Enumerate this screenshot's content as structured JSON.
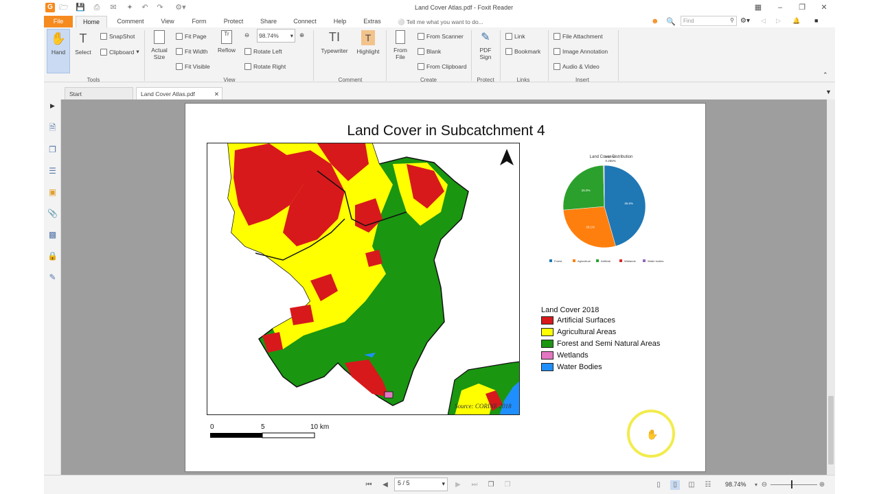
{
  "window": {
    "title": "Land Cover Atlas.pdf - Foxit Reader",
    "logo": "G"
  },
  "ribbon_tabs": [
    "File",
    "Home",
    "Comment",
    "View",
    "Form",
    "Protect",
    "Share",
    "Connect",
    "Help",
    "Extras"
  ],
  "tell_me": "Tell me what you want to do...",
  "find_placeholder": "Find",
  "tools": {
    "hand": "Hand",
    "select": "Select",
    "snapshot": "SnapShot",
    "clipboard": "Clipboard",
    "actual_size": "Actual Size",
    "fit_page": "Fit Page",
    "fit_width": "Fit Width",
    "fit_visible": "Fit Visible",
    "reflow": "Reflow",
    "zoom_value": "98.74%",
    "rotate_left": "Rotate Left",
    "rotate_right": "Rotate Right",
    "typewriter": "Typewriter",
    "highlight": "Highlight",
    "from_file": "From File",
    "from_scanner": "From Scanner",
    "blank": "Blank",
    "from_clipboard": "From Clipboard",
    "pdf_sign": "PDF Sign",
    "link": "Link",
    "bookmark": "Bookmark",
    "file_attachment": "File Attachment",
    "image_annotation": "Image Annotation",
    "audio_video": "Audio & Video"
  },
  "groups": {
    "tools": "Tools",
    "view": "View",
    "comment": "Comment",
    "create": "Create",
    "protect": "Protect",
    "links": "Links",
    "insert": "Insert"
  },
  "doc_tabs": [
    "Start",
    "Land Cover Atlas.pdf"
  ],
  "page": {
    "title": "Land Cover in Subcatchment 4",
    "pie_title": "Land Cover Distribution",
    "pie_labels": [
      "45.6%",
      "28.1%",
      "26.0%",
      "0.137%",
      "0.255%"
    ],
    "pie_legend": [
      "Forest",
      "Agriculture",
      "Artificial",
      "Wetlands",
      "Water bodies"
    ],
    "legend_title": "Land Cover 2018",
    "legend": [
      {
        "label": "Artificial Surfaces",
        "color": "#d7191c"
      },
      {
        "label": "Agricultural Areas",
        "color": "#ffff00"
      },
      {
        "label": "Forest and Semi Natural Areas",
        "color": "#1a9611"
      },
      {
        "label": "Wetlands",
        "color": "#e377c2"
      },
      {
        "label": "Water Bodies",
        "color": "#1f8fff"
      }
    ],
    "source": "Source: CORINE 2018",
    "scale": {
      "labels": [
        "0",
        "5",
        "10 km"
      ]
    }
  },
  "chart_data": {
    "type": "pie",
    "title": "Land Cover Distribution",
    "categories": [
      "Forest",
      "Agriculture",
      "Artificial",
      "Wetlands",
      "Water bodies"
    ],
    "values": [
      45.6,
      28.1,
      26.0,
      0.137,
      0.255
    ],
    "colors": [
      "#1f77b4",
      "#ff7f0e",
      "#2ca02c",
      "#d62728",
      "#9467bd"
    ],
    "legend": "bottom"
  },
  "status": {
    "page_indicator": "5 / 5",
    "zoom": "98.74%"
  }
}
